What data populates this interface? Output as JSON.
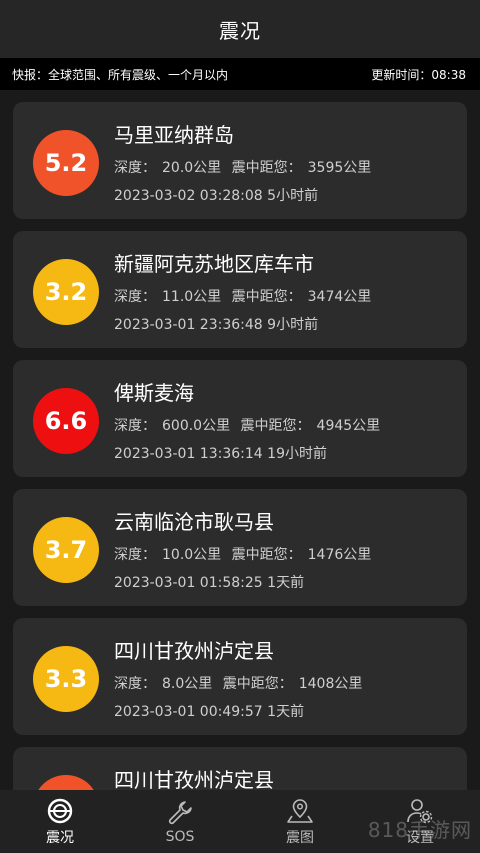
{
  "header": {
    "title": "震况"
  },
  "infobar": {
    "left_text": "快报：全球范围、所有震级、一个月以内",
    "update_label": "更新时间：",
    "update_time": "08:38"
  },
  "labels": {
    "depth": "深度：",
    "distance": "震中距您："
  },
  "quakes": [
    {
      "mag": "5.2",
      "place": "马里亚纳群岛",
      "depth": "20.0公里",
      "distance": "3595公里",
      "datetime": "2023-03-02 03:28:08",
      "ago": "5小时前",
      "color": "#f0522a"
    },
    {
      "mag": "3.2",
      "place": "新疆阿克苏地区库车市",
      "depth": "11.0公里",
      "distance": "3474公里",
      "datetime": "2023-03-01 23:36:48",
      "ago": "9小时前",
      "color": "#f6b812"
    },
    {
      "mag": "6.6",
      "place": "俾斯麦海",
      "depth": "600.0公里",
      "distance": "4945公里",
      "datetime": "2023-03-01 13:36:14",
      "ago": "19小时前",
      "color": "#ee1010"
    },
    {
      "mag": "3.7",
      "place": "云南临沧市耿马县",
      "depth": "10.0公里",
      "distance": "1476公里",
      "datetime": "2023-03-01 01:58:25",
      "ago": "1天前",
      "color": "#f6b812"
    },
    {
      "mag": "3.3",
      "place": "四川甘孜州泸定县",
      "depth": "8.0公里",
      "distance": "1408公里",
      "datetime": "2023-03-01 00:49:57",
      "ago": "1天前",
      "color": "#f6b812"
    },
    {
      "mag": "",
      "place": "四川甘孜州泸定县",
      "depth": "",
      "distance": "",
      "datetime": "",
      "ago": "",
      "color": "#f0522a"
    }
  ],
  "tabs": [
    {
      "label": "震况",
      "icon": "quake-status-icon"
    },
    {
      "label": "SOS",
      "icon": "wrench-icon"
    },
    {
      "label": "震图",
      "icon": "map-pin-icon"
    },
    {
      "label": "设置",
      "icon": "user-settings-icon"
    }
  ],
  "watermark": "818手游网"
}
